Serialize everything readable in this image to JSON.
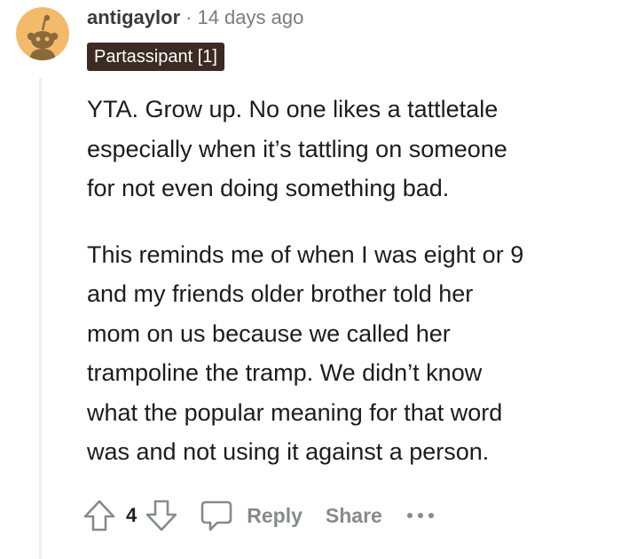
{
  "comment": {
    "author": "antigaylor",
    "separator": "·",
    "timestamp": "14 days ago",
    "flair": "Partassipant [1]",
    "paragraphs": [
      "YTA. Grow up. No one likes a tattletale\nespecially when it’s tattling on someone\nfor not even doing something bad.",
      "This reminds me of when I was eight or 9\nand my friends older brother told her\nmom on us because we called her\ntrampoline the tramp. We didn’t know\nwhat the popular meaning for that word\nwas and not using it against a person."
    ]
  },
  "actions": {
    "vote_count": "4",
    "reply_label": "Reply",
    "share_label": "Share"
  },
  "icons": {
    "avatar": "snoo-avatar-icon",
    "upvote": "upvote-arrow-icon",
    "downvote": "downvote-arrow-icon",
    "reply": "speech-bubble-icon",
    "more": "more-options-icon"
  },
  "colors": {
    "avatar_bg": "#f2ba6a",
    "avatar_figure": "#8a6a3a",
    "flair_bg": "#3c2b23",
    "muted_text": "#878a8c",
    "thread_line": "#edeff1"
  }
}
